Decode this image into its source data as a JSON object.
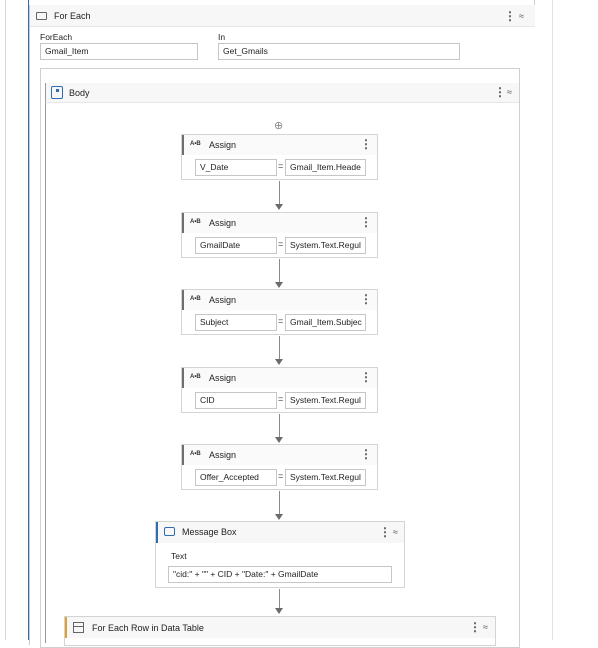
{
  "foreach": {
    "title": "For Each",
    "foreach_label": "ForEach",
    "foreach_value": "Gmail_Item",
    "in_label": "In",
    "in_value": "Get_Gmails"
  },
  "body": {
    "title": "Body"
  },
  "add_icon": "⊕",
  "assigns": [
    {
      "title": "Assign",
      "badge": "A•B",
      "lhs": "V_Date",
      "eq": "=",
      "rhs": "Gmail_Item.Heade"
    },
    {
      "title": "Assign",
      "badge": "A•B",
      "lhs": "GmailDate",
      "eq": "=",
      "rhs": "System.Text.Regul"
    },
    {
      "title": "Assign",
      "badge": "A•B",
      "lhs": "Subject",
      "eq": "=",
      "rhs": "Gmail_Item.Subjec"
    },
    {
      "title": "Assign",
      "badge": "A•B",
      "lhs": "CID",
      "eq": "=",
      "rhs": "System.Text.Regul"
    },
    {
      "title": "Assign",
      "badge": "A•B",
      "lhs": "Offer_Accepted",
      "eq": "=",
      "rhs": "System.Text.Regul"
    }
  ],
  "message_box": {
    "title": "Message Box",
    "text_label": "Text",
    "text_value": "\"cid:\" + \"\" + CID + \"Date:\" + GmailDate"
  },
  "for_each_row": {
    "title": "For Each Row in Data Table"
  }
}
